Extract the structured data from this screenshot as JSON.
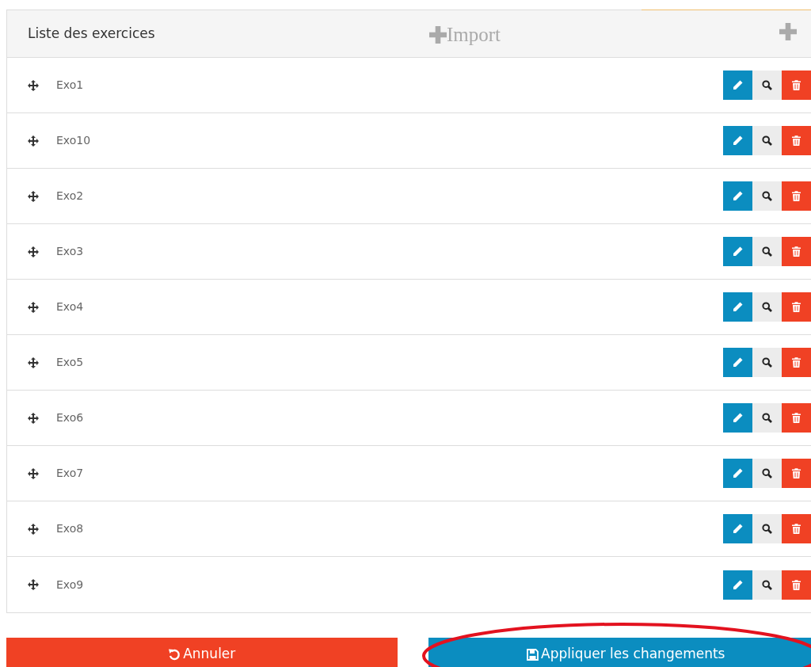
{
  "panel": {
    "title": "Liste des exercices",
    "import_label": "Import"
  },
  "exercises": [
    {
      "name": "Exo1"
    },
    {
      "name": "Exo10"
    },
    {
      "name": "Exo2"
    },
    {
      "name": "Exo3"
    },
    {
      "name": "Exo4"
    },
    {
      "name": "Exo5"
    },
    {
      "name": "Exo6"
    },
    {
      "name": "Exo7"
    },
    {
      "name": "Exo8"
    },
    {
      "name": "Exo9"
    }
  ],
  "buttons": [
    {
      "kind": "cancel",
      "label": "Annuler",
      "highlighted": false
    },
    {
      "kind": "apply",
      "label": "Appliquer les changements",
      "highlighted": true
    }
  ]
}
